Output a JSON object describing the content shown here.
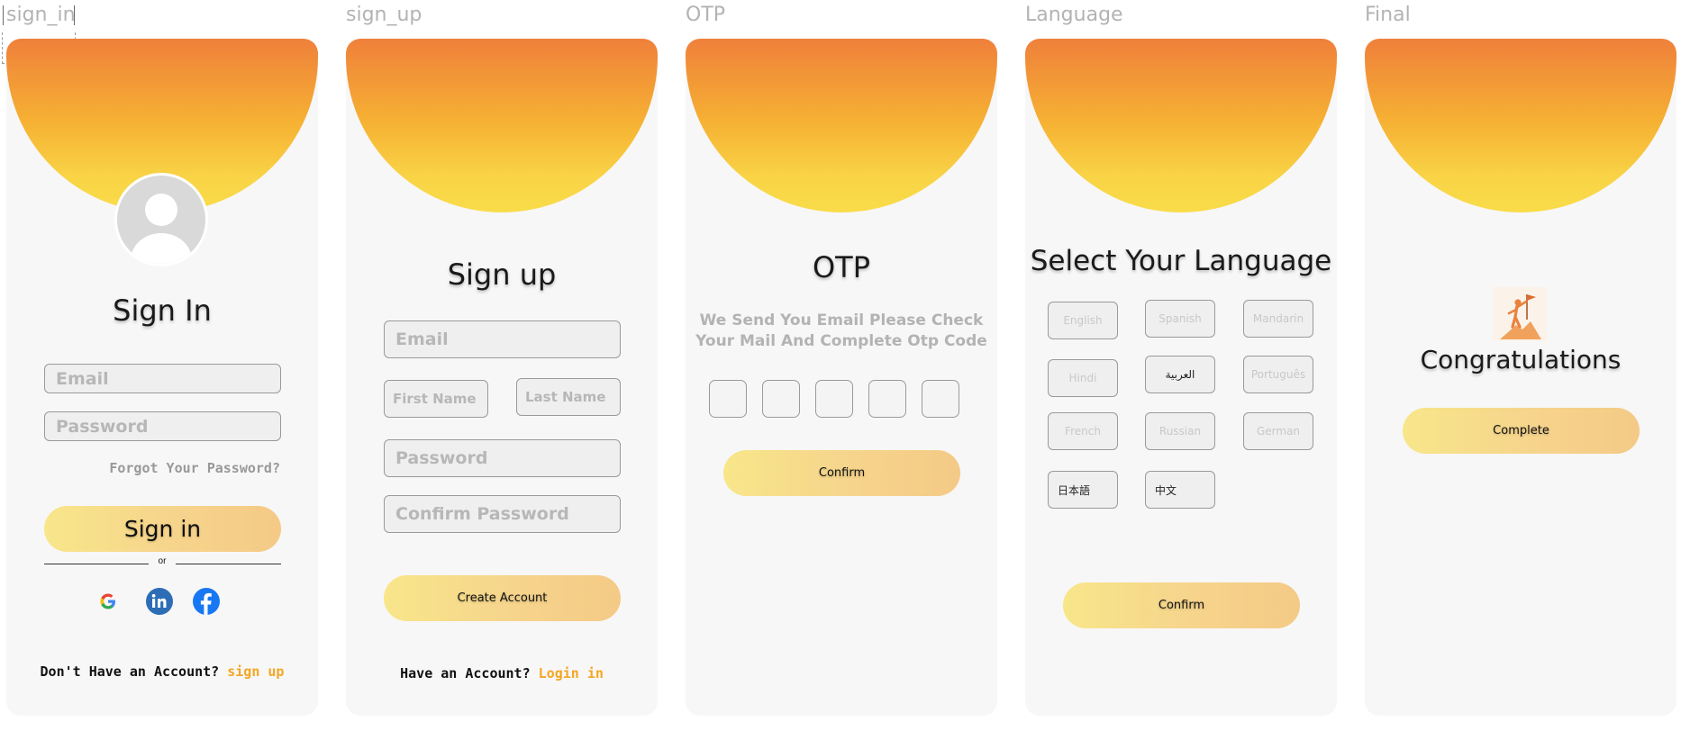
{
  "labels": {
    "sign_in": "sign_in",
    "sign_up": "sign_up",
    "otp": "OTP",
    "language": "Language",
    "final": "Final"
  },
  "signin": {
    "title": "Sign In",
    "email_placeholder": "Email",
    "password_placeholder": "Password",
    "forgot": "Forgot Your Password?",
    "button": "Sign in",
    "or": "or",
    "no_account": "Don't Have an Account?",
    "signup_link": "sign up"
  },
  "signup": {
    "title": "Sign up",
    "email_placeholder": "Email",
    "first_name_placeholder": "First Name",
    "last_name_placeholder": "Last Name",
    "password_placeholder": "Password",
    "confirm_password_placeholder": "Confirm Password",
    "button": "Create Account",
    "have_account": "Have an Account?",
    "login_link": "Login in"
  },
  "otp": {
    "title": "OTP",
    "message": "We Send You Email Please Check Your Mail And Complete Otp Code",
    "button": "Confirm"
  },
  "language": {
    "title": "Select Your Language",
    "options": [
      "English",
      "Spanish",
      "Mandarin",
      "Hindi",
      "العربية",
      "Português",
      "French",
      "Russian",
      "German",
      "日本語",
      "中文"
    ],
    "button": "Confirm"
  },
  "final": {
    "title": "Congratulations",
    "button": "Complete"
  },
  "colors": {
    "accent_orange": "#ef803b",
    "accent_yellow": "#f9d446",
    "link_orange": "#f5a623"
  }
}
